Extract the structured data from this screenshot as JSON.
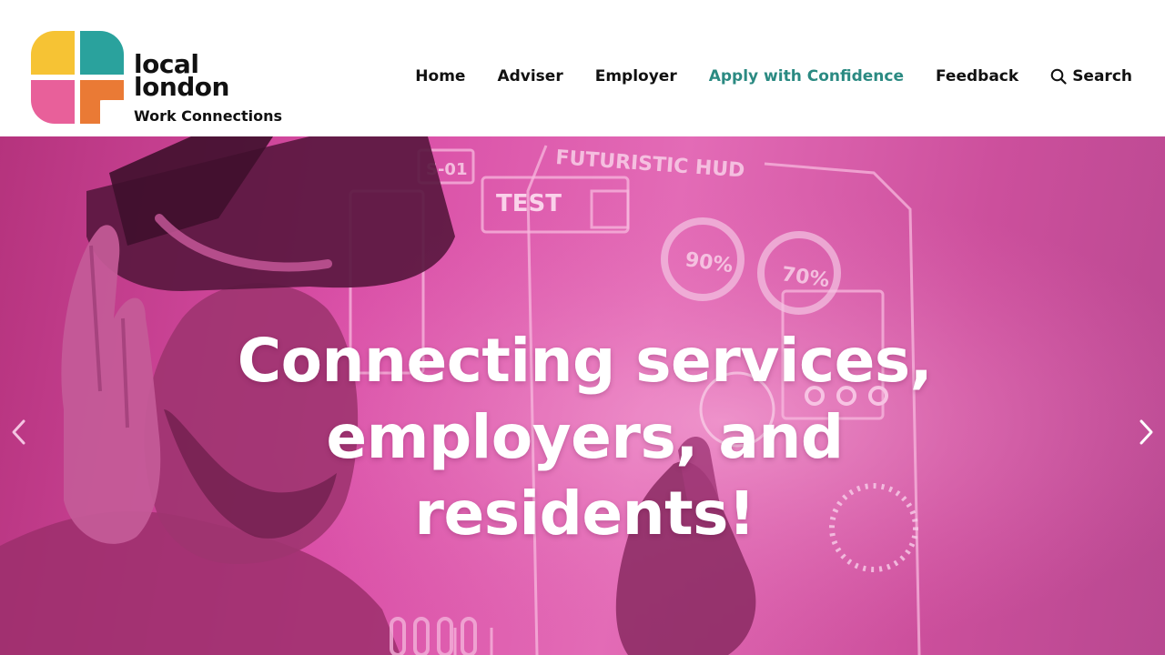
{
  "brand": {
    "name_line1": "local",
    "name_line2": "london",
    "tagline": "Work Connections",
    "colors": {
      "yellow": "#f6c334",
      "teal": "#2aa29d",
      "pink": "#e8609a",
      "orange": "#ea7a35"
    }
  },
  "nav": {
    "items": [
      {
        "label": "Home",
        "active": false
      },
      {
        "label": "Adviser",
        "active": false
      },
      {
        "label": "Employer",
        "active": false
      },
      {
        "label": "Apply with Confidence",
        "active": true
      },
      {
        "label": "Feedback",
        "active": false
      },
      {
        "label": "Search",
        "icon": "search-icon",
        "active": false
      }
    ],
    "active_color": "#2b8a82"
  },
  "hero": {
    "title": "Connecting services, employers, and residents!",
    "hud_labels": {
      "heading": "FUTURISTIC HUD",
      "code": "S-01",
      "test": "TEST",
      "gauge_1": "90%",
      "gauge_2": "70%"
    },
    "prev_icon": "chevron-left-icon",
    "next_icon": "chevron-right-icon",
    "overlay_color": "#d94ea6"
  }
}
